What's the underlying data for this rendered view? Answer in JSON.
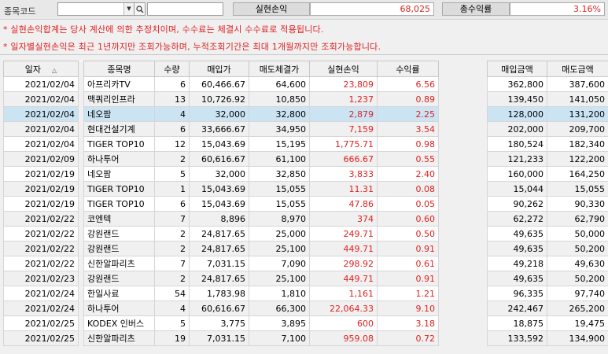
{
  "filter": {
    "code_label": "종목코드",
    "code_value": "",
    "name_value": ""
  },
  "summary": {
    "realized_label": "실현손익",
    "realized_value": "68,025",
    "rate_label": "총수익률",
    "rate_value": "3.16%"
  },
  "notes": [
    "* 실현손익합계는 당사 계산에 의한 추정치이며, 수수료는 체결시 수수료로 적용됩니다.",
    "* 일자별실현손익은 최근 1년까지만 조회가능하며, 누적조회기간은 최대 1개월까지만 조회가능합니다."
  ],
  "table1": {
    "headers": [
      "일자",
      "종목명",
      "수량",
      "매입가",
      "매도체결가",
      "실현손익",
      "수익률"
    ]
  },
  "table2": {
    "headers": [
      "매입금액",
      "매도금액"
    ]
  },
  "rows": [
    {
      "date": "2021/02/04",
      "name": "아프리카TV",
      "qty": "6",
      "buy": "60,466.67",
      "sell": "64,600",
      "pnl": "23,809",
      "rate": "6.56",
      "buy_amt": "362,800",
      "sell_amt": "387,600"
    },
    {
      "date": "2021/02/04",
      "name": "맥쿼리인프라",
      "qty": "13",
      "buy": "10,726.92",
      "sell": "10,850",
      "pnl": "1,237",
      "rate": "0.89",
      "buy_amt": "139,450",
      "sell_amt": "141,050"
    },
    {
      "date": "2021/02/04",
      "name": "네오팜",
      "qty": "4",
      "buy": "32,000",
      "sell": "32,800",
      "pnl": "2,879",
      "rate": "2.25",
      "buy_amt": "128,000",
      "sell_amt": "131,200"
    },
    {
      "date": "2021/02/04",
      "name": "현대건설기계",
      "qty": "6",
      "buy": "33,666.67",
      "sell": "34,950",
      "pnl": "7,159",
      "rate": "3.54",
      "buy_amt": "202,000",
      "sell_amt": "209,700"
    },
    {
      "date": "2021/02/04",
      "name": "TIGER TOP10",
      "qty": "12",
      "buy": "15,043.69",
      "sell": "15,195",
      "pnl": "1,775.71",
      "rate": "0.98",
      "buy_amt": "180,524",
      "sell_amt": "182,340"
    },
    {
      "date": "2021/02/09",
      "name": "하나투어",
      "qty": "2",
      "buy": "60,616.67",
      "sell": "61,100",
      "pnl": "666.67",
      "rate": "0.55",
      "buy_amt": "121,233",
      "sell_amt": "122,200"
    },
    {
      "date": "2021/02/19",
      "name": "네오팜",
      "qty": "5",
      "buy": "32,000",
      "sell": "32,850",
      "pnl": "3,833",
      "rate": "2.40",
      "buy_amt": "160,000",
      "sell_amt": "164,250"
    },
    {
      "date": "2021/02/19",
      "name": "TIGER TOP10",
      "qty": "1",
      "buy": "15,043.69",
      "sell": "15,055",
      "pnl": "11.31",
      "rate": "0.08",
      "buy_amt": "15,044",
      "sell_amt": "15,055"
    },
    {
      "date": "2021/02/19",
      "name": "TIGER TOP10",
      "qty": "6",
      "buy": "15,043.69",
      "sell": "15,055",
      "pnl": "47.86",
      "rate": "0.05",
      "buy_amt": "90,262",
      "sell_amt": "90,330"
    },
    {
      "date": "2021/02/22",
      "name": "코엔텍",
      "qty": "7",
      "buy": "8,896",
      "sell": "8,970",
      "pnl": "374",
      "rate": "0.60",
      "buy_amt": "62,272",
      "sell_amt": "62,790"
    },
    {
      "date": "2021/02/22",
      "name": "강원랜드",
      "qty": "2",
      "buy": "24,817.65",
      "sell": "25,000",
      "pnl": "249.71",
      "rate": "0.50",
      "buy_amt": "49,635",
      "sell_amt": "50,000"
    },
    {
      "date": "2021/02/22",
      "name": "강원랜드",
      "qty": "2",
      "buy": "24,817.65",
      "sell": "25,100",
      "pnl": "449.71",
      "rate": "0.91",
      "buy_amt": "49,635",
      "sell_amt": "50,200"
    },
    {
      "date": "2021/02/22",
      "name": "신한알파리츠",
      "qty": "7",
      "buy": "7,031.15",
      "sell": "7,090",
      "pnl": "298.92",
      "rate": "0.61",
      "buy_amt": "49,218",
      "sell_amt": "49,630"
    },
    {
      "date": "2021/02/23",
      "name": "강원랜드",
      "qty": "2",
      "buy": "24,817.65",
      "sell": "25,100",
      "pnl": "449.71",
      "rate": "0.91",
      "buy_amt": "49,635",
      "sell_amt": "50,200"
    },
    {
      "date": "2021/02/24",
      "name": "한일사료",
      "qty": "54",
      "buy": "1,783.98",
      "sell": "1,810",
      "pnl": "1,161",
      "rate": "1.21",
      "buy_amt": "96,335",
      "sell_amt": "97,740"
    },
    {
      "date": "2021/02/24",
      "name": "하나투어",
      "qty": "4",
      "buy": "60,616.67",
      "sell": "66,300",
      "pnl": "22,064.33",
      "rate": "9.10",
      "buy_amt": "242,467",
      "sell_amt": "265,200"
    },
    {
      "date": "2021/02/25",
      "name": "KODEX 인버스",
      "qty": "5",
      "buy": "3,775",
      "sell": "3,895",
      "pnl": "600",
      "rate": "3.18",
      "buy_amt": "18,875",
      "sell_amt": "19,475"
    },
    {
      "date": "2021/02/25",
      "name": "신한알파리츠",
      "qty": "19",
      "buy": "7,031.15",
      "sell": "7,100",
      "pnl": "959.08",
      "rate": "0.72",
      "buy_amt": "133,592",
      "sell_amt": "134,900"
    }
  ],
  "selected_row": 2,
  "colors": {
    "profit_red": "#e02020",
    "selected_row": "#cbe4f4",
    "zebra_row": "#f0f0f0"
  },
  "icons": {
    "combo": "chevron-down-icon",
    "search": "search-icon",
    "sort": "sort-up-icon"
  }
}
